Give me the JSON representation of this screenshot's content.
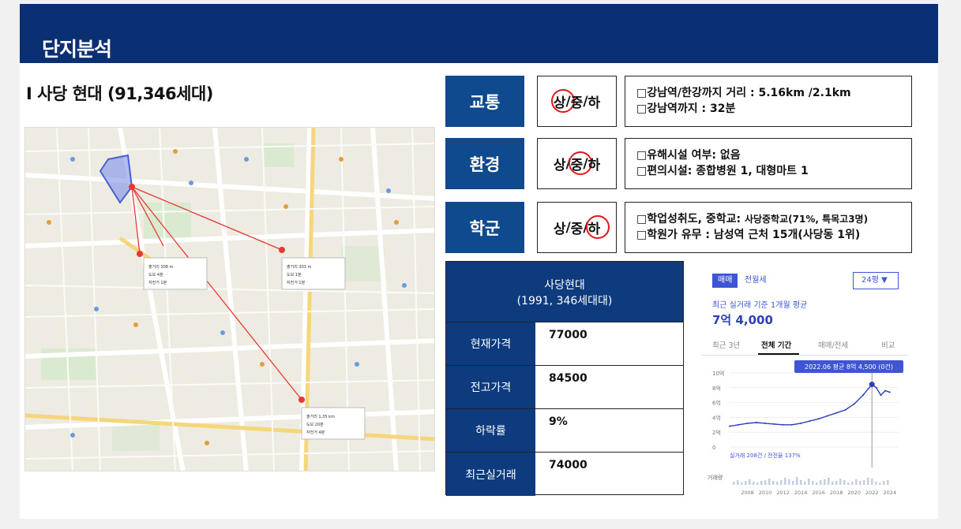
{
  "header": {
    "title": "단지분석"
  },
  "subtitle": "I 사당 현대 (91,346세대)",
  "map": {
    "popups": [
      {
        "rows": [
          "출거리 308 m",
          "도보 4분",
          "자전거 1분"
        ]
      },
      {
        "rows": [
          "출거리 303 m",
          "도보 1분",
          "자전거 1분"
        ]
      },
      {
        "rows": [
          "출거리 1.35 km",
          "도보 20분",
          "자전거 4분"
        ]
      }
    ]
  },
  "criteria": [
    {
      "label": "교통",
      "ratings": [
        "상",
        "중",
        "하"
      ],
      "selected": 0,
      "details": [
        "□강남역/한강까지 거리 : 5.16km /2.1km",
        "□강남역까지 : 32분"
      ]
    },
    {
      "label": "환경",
      "ratings": [
        "상",
        "중",
        "하"
      ],
      "selected": 1,
      "details": [
        "□유해시설 여부:  없음",
        "□편의시설: 종합병원 1, 대형마트 1"
      ]
    },
    {
      "label": "학군",
      "ratings": [
        "상",
        "중",
        "하"
      ],
      "selected": 2,
      "details_line1_main": "□학업성취도, 중학교: ",
      "details_line1_small": "사당중학교(71%, 특목고3명)",
      "details_line2": "□학원가 유무 : 남성역 근처 15개(사당동 1위)"
    }
  ],
  "price_table": {
    "title_line1": "사당현대",
    "title_line2": "(1991, 346세대대)",
    "rows": [
      {
        "label": "현재가격",
        "value": "77000"
      },
      {
        "label": "전고가격",
        "value": "84500"
      },
      {
        "label": "하락률",
        "value": "9%"
      },
      {
        "label": "최근실거래",
        "value": "74000"
      }
    ]
  },
  "price_panel": {
    "tabs": [
      "매매",
      "전월세"
    ],
    "active_tab": 0,
    "size_select": "24평 ▼",
    "note": "최근 실거래 기준 1개월 평균",
    "price": "7억 4,000",
    "subtabs": [
      "최근 3년",
      "전체 기간",
      "매매/전세",
      "비교"
    ],
    "active_subtab": 1,
    "tooltip": "2022.06 평균 8억 4,500 (0건)",
    "footnote": "실거래 208건 / 전전율 137%",
    "volume_label": "거래량",
    "colors": {
      "accent": "#3e55d4",
      "line": "#2b3fb8"
    }
  },
  "chart_data": {
    "type": "line",
    "title": "",
    "xlabel": "",
    "ylabel": "",
    "x_ticks": [
      "2008",
      "2010",
      "2012",
      "2014",
      "2016",
      "2018",
      "2020",
      "2022",
      "2024"
    ],
    "y_ticks": [
      "0",
      "2억",
      "4억",
      "6억",
      "8억",
      "10억"
    ],
    "ylim": [
      0,
      10
    ],
    "x": [
      2006,
      2007,
      2008,
      2009,
      2010,
      2011,
      2012,
      2013,
      2014,
      2015,
      2016,
      2017,
      2018,
      2019,
      2020,
      2021,
      2022,
      2022.5,
      2023,
      2023.5,
      2024
    ],
    "values": [
      2.8,
      3.0,
      3.2,
      3.3,
      3.2,
      3.1,
      3.0,
      3.0,
      3.2,
      3.5,
      3.8,
      4.2,
      4.6,
      5.0,
      5.8,
      7.0,
      8.45,
      8.0,
      7.0,
      7.6,
      7.4
    ],
    "series": [
      {
        "values": [
          2.8,
          3.0,
          3.2,
          3.3,
          3.2,
          3.1,
          3.0,
          3.0,
          3.2,
          3.5,
          3.8,
          4.2,
          4.6,
          5.0,
          5.8,
          7.0,
          8.45,
          8.0,
          7.0,
          7.6,
          7.4
        ]
      }
    ]
  }
}
